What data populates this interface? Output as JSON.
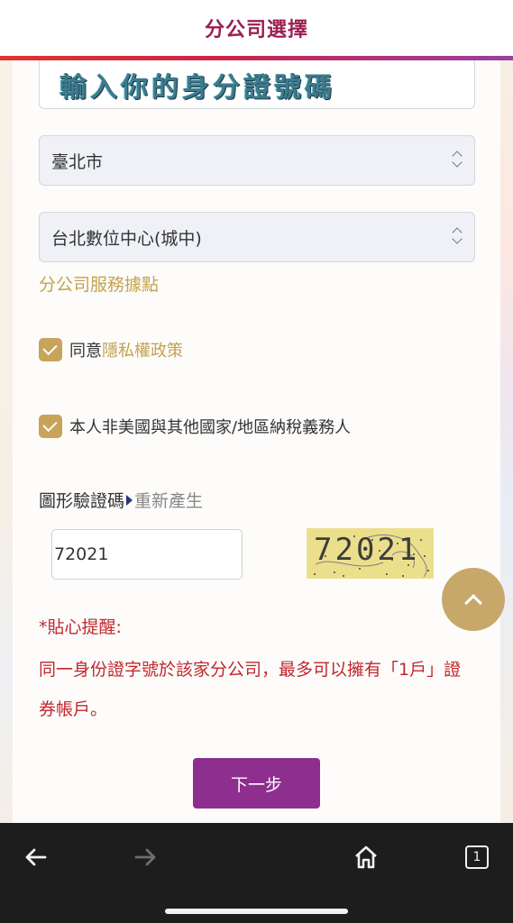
{
  "header": {
    "title": "分公司選擇"
  },
  "form": {
    "id_placeholder": "輸入你的身分證號碼",
    "city_select": {
      "value": "臺北市"
    },
    "branch_select": {
      "value": "台北數位中心(城中)"
    },
    "branch_link": "分公司服務據點",
    "privacy": {
      "prefix": "同意",
      "link": "隱私權政策",
      "checked": true
    },
    "tax": {
      "label": "本人非美國與其他國家/地區納稅義務人",
      "checked": true
    },
    "captcha": {
      "label": "圖形驗證碼",
      "regen_label": "重新產生",
      "input_value": "72021",
      "image_text": "72021"
    },
    "reminder": {
      "title": "*貼心提醒:",
      "body": "同一身份證字號於該家分公司，最多可以擁有「1戶」證券帳戶。"
    },
    "next_label": "下一步"
  },
  "browser": {
    "tab_count": "1"
  },
  "colors": {
    "header_title": "#9b1f52",
    "gold": "#c8a45a",
    "reminder_red": "#c0282d",
    "next_button": "#8e2e8f"
  },
  "icons": [
    "chevron-up-icon",
    "back-arrow-icon",
    "forward-arrow-icon",
    "home-icon",
    "tabs-icon",
    "checkmark-icon",
    "select-caret-icon"
  ]
}
